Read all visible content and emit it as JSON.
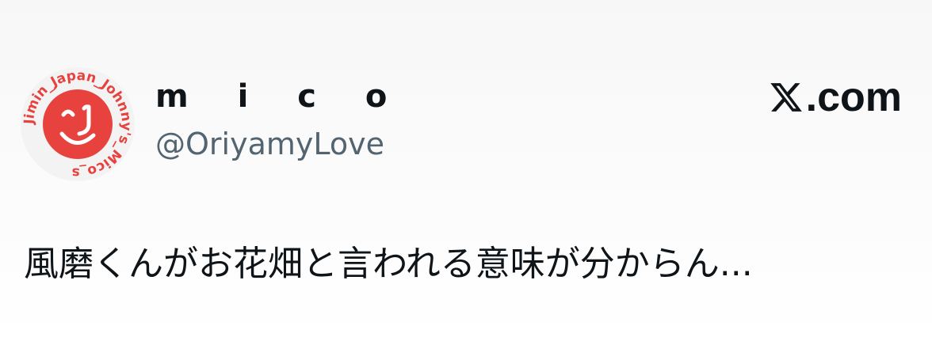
{
  "user": {
    "display_name": "m i c o",
    "handle": "@OriyamyLove",
    "avatar_icon": "smiley-stamp-icon",
    "avatar_ring_text": "Jimin_Japan_Johnny's_Mico_s",
    "avatar_color": "#e8423f"
  },
  "brand": {
    "icon": "x-logo-icon",
    "label": ".com"
  },
  "tweet": {
    "text": "風磨くんがお花畑と言われる意味が分からん..."
  },
  "colors": {
    "text_primary": "#0f1419",
    "text_secondary": "#536471",
    "background": "#f7f7f7"
  }
}
